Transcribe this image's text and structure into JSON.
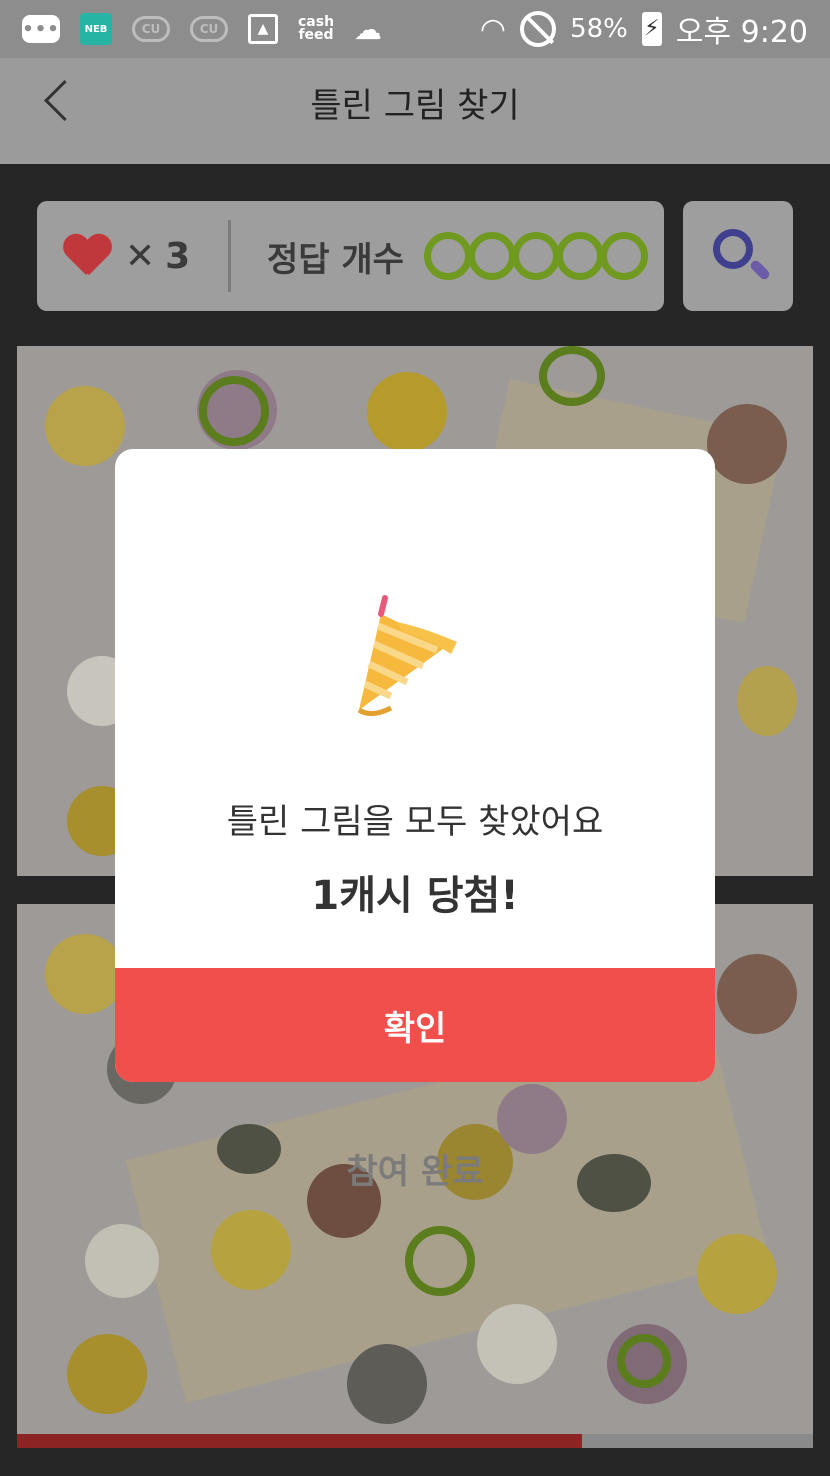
{
  "status_bar": {
    "icons": [
      "chat-icon",
      "neb-icon",
      "cu-icon",
      "cu-icon",
      "gallery-icon",
      "cashfeed-icon",
      "cloud-icon",
      "wifi-icon",
      "do-not-disturb-icon",
      "battery-charging-icon"
    ],
    "neb_label": "NEB",
    "cu_label": "CU",
    "cashfeed_label": "cash\nfeed",
    "battery": "58%",
    "time": "오후 9:20"
  },
  "header": {
    "title": "틀린 그림 찾기"
  },
  "game": {
    "lives_symbol": "✕",
    "lives_count": "3",
    "answer_label": "정답 개수",
    "answers_found": 5,
    "answers_total": 5,
    "completed_text": "참여 완료",
    "progress": 0.71
  },
  "dialog": {
    "icon": "party-popper-icon",
    "message": "틀린 그림을 모두 찾았어요",
    "prize": "1캐시 당첨!",
    "confirm_label": "확인"
  },
  "colors": {
    "accent": "#f14f4b",
    "found_ring": "#6f9a1f",
    "heart": "#c0383b"
  }
}
